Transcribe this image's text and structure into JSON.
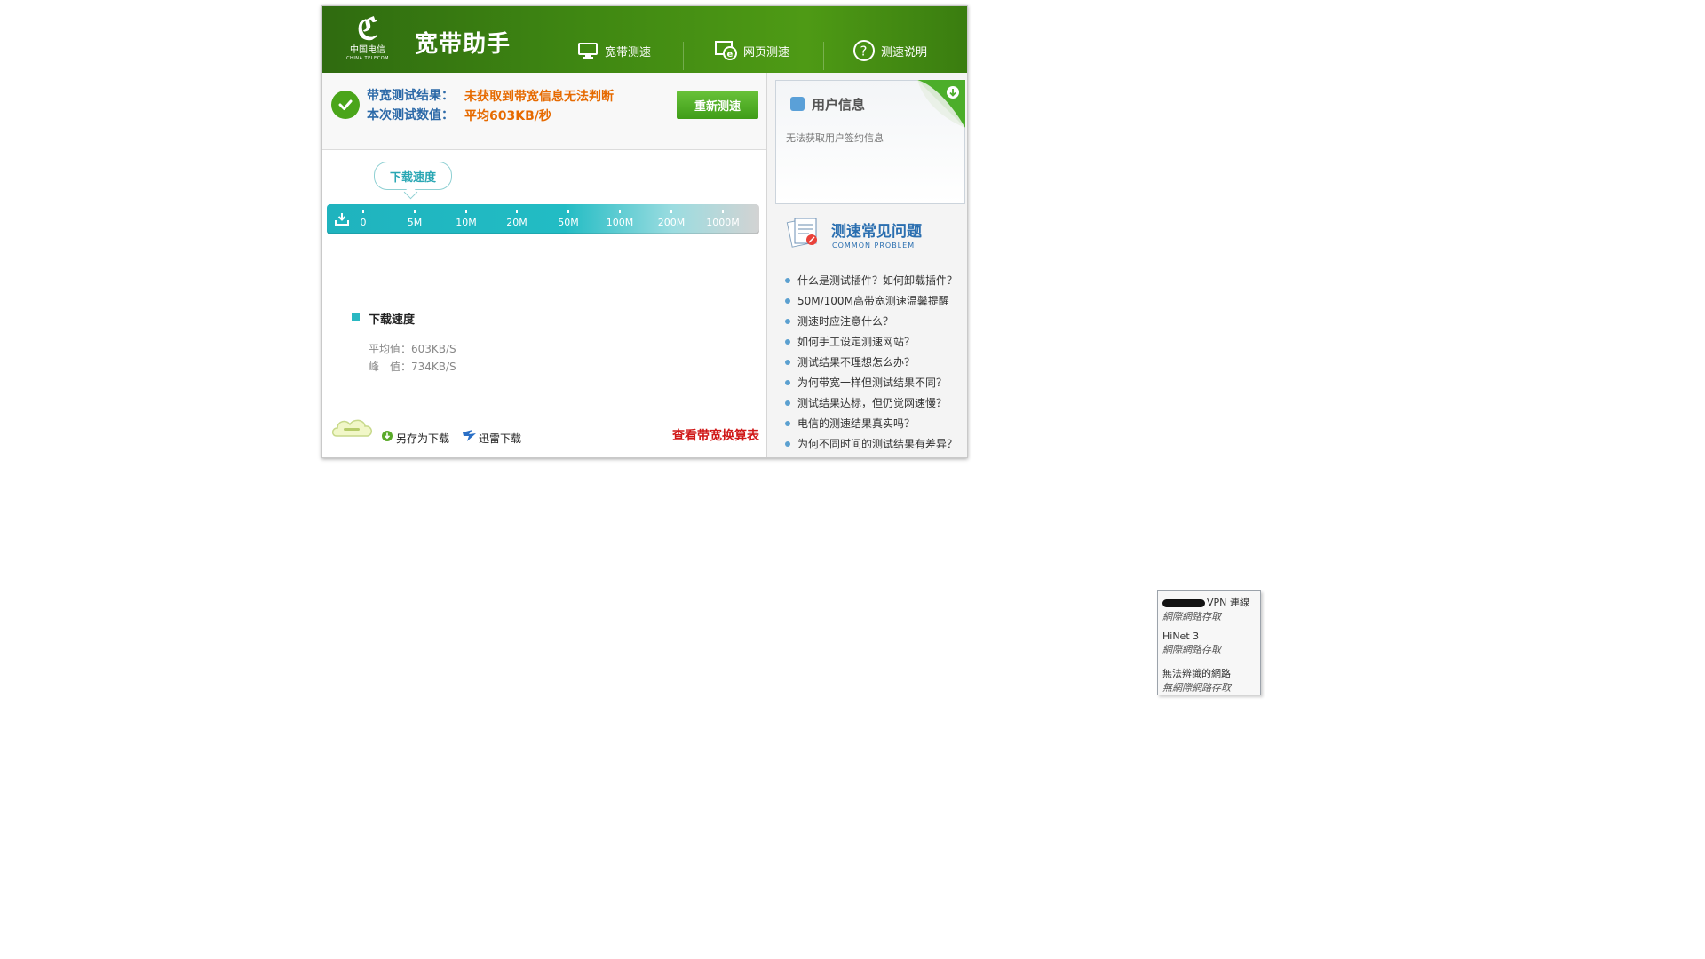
{
  "header": {
    "logo_cn": "中国电信",
    "logo_en": "CHINA TELECOM",
    "title": "宽带助手",
    "nav": [
      {
        "label": "宽带测速",
        "icon": "monitor-icon"
      },
      {
        "label": "网页测速",
        "icon": "browser-e-icon"
      },
      {
        "label": "测速说明",
        "icon": "question-icon"
      }
    ]
  },
  "result": {
    "label1": "带宽测试结果：",
    "value1": "未获取到带宽信息无法判断",
    "label2": "本次测试数值：",
    "value2": "平均603KB/秒",
    "retest_button": "重新测速"
  },
  "speed_meter": {
    "bubble_label": "下载速度",
    "ticks": [
      "0",
      "5M",
      "10M",
      "20M",
      "50M",
      "100M",
      "200M",
      "1000M"
    ]
  },
  "stats": {
    "legend_label": "下载速度",
    "avg": "平均值：603KB/S",
    "peak": "峰　值：734KB/S"
  },
  "footer": {
    "save_download": "另存为下载",
    "thunder_download": "迅雷下载",
    "convert_link": "查看带宽换算表"
  },
  "user_info": {
    "title": "用户信息",
    "message": "无法获取用户签约信息"
  },
  "faq": {
    "title": "测速常见问题",
    "subtitle": "COMMON PROBLEM",
    "items": [
      "什么是测试插件？如何卸载插件？",
      "50M/100M高带宽测速温馨提醒",
      "测速时应注意什么？",
      "如何手工设定测速网站？",
      "测试结果不理想怎么办？",
      "为何带宽一样但测试结果不同？",
      "测试结果达标，但仍觉网速慢？",
      "电信的测速结果真实吗？",
      "为何不同时间的测试结果有差异？"
    ]
  },
  "network_popup": {
    "entries": [
      {
        "name": "VPN 連線",
        "status": "網際網路存取"
      },
      {
        "name": "HiNet 3",
        "status": "網際網路存取"
      },
      {
        "name": "無法辨識的網路",
        "status": "無網際網路存取"
      }
    ]
  },
  "colors": {
    "header_green": "#3f8712",
    "accent_teal": "#22bcc4",
    "link_blue": "#2d6aa8",
    "warn_orange": "#e66a00",
    "link_red": "#d01818"
  }
}
